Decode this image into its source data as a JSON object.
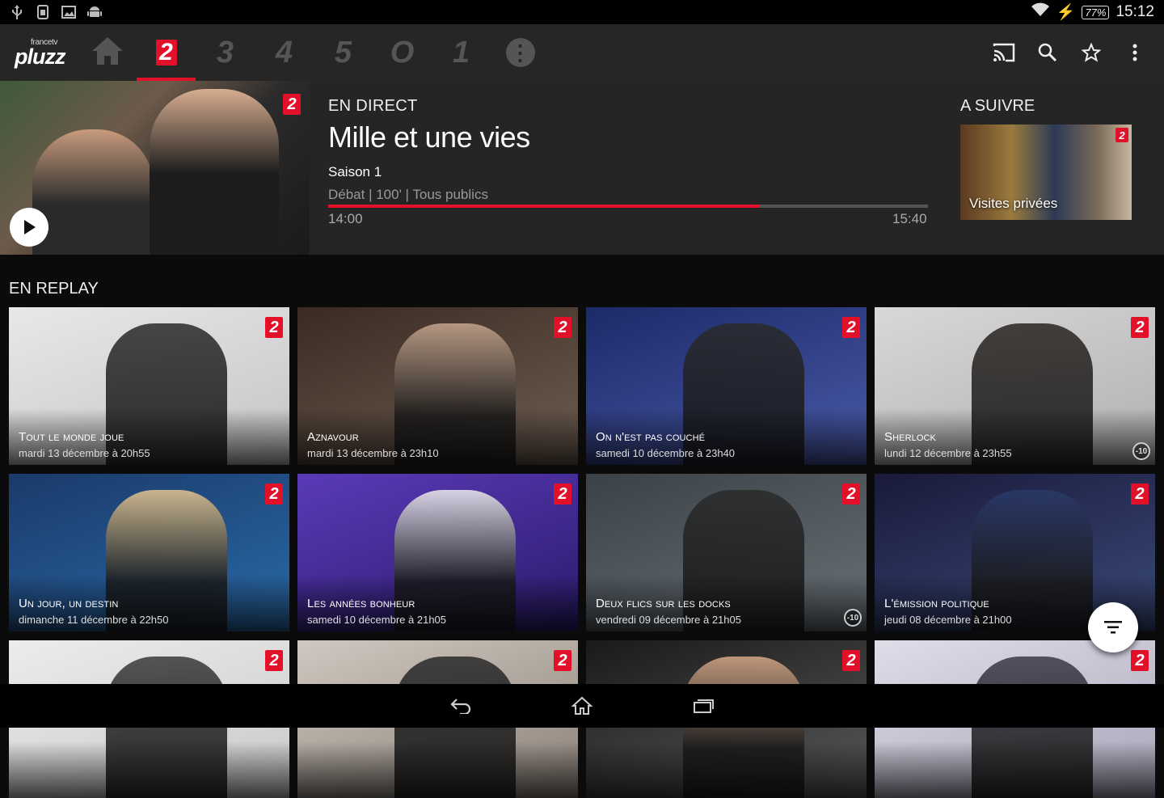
{
  "status_bar": {
    "time": "15:12",
    "battery": "77%",
    "left_icons": [
      "usb-icon",
      "sim-icon",
      "image-icon",
      "android-icon"
    ]
  },
  "app_bar": {
    "logo_small": "francetv",
    "logo_main": "pluzz",
    "channels": [
      {
        "icon": "home-icon",
        "label": "⌂",
        "active": false
      },
      {
        "icon": "channel-2-icon",
        "label": "2",
        "active": true
      },
      {
        "icon": "channel-3-icon",
        "label": "3",
        "active": false
      },
      {
        "icon": "channel-4-icon",
        "label": "4",
        "active": false
      },
      {
        "icon": "channel-5-icon",
        "label": "5",
        "active": false
      },
      {
        "icon": "channel-o-icon",
        "label": "O",
        "active": false
      },
      {
        "icon": "channel-1-icon",
        "label": "1",
        "active": false
      },
      {
        "icon": "more-channels-icon",
        "label": "⋮",
        "active": false
      }
    ],
    "actions": [
      "cast-icon",
      "search-icon",
      "favorite-star-icon",
      "overflow-menu-icon"
    ]
  },
  "live": {
    "label": "EN DIRECT",
    "title": "Mille et une vies",
    "season": "Saison 1",
    "meta": "Débat | 100' | Tous publics",
    "start": "14:00",
    "end": "15:40",
    "progress": 0.72,
    "channel_badge": "2"
  },
  "next": {
    "label": "A SUIVRE",
    "title": "Visites privées",
    "channel_badge": "2"
  },
  "replay": {
    "header": "EN REPLAY",
    "cards": [
      {
        "title": "Tout le monde joue",
        "date": "mardi 13 décembre à 20h55",
        "badge": "2",
        "rating": ""
      },
      {
        "title": "Aznavour",
        "date": "mardi 13 décembre à 23h10",
        "badge": "2",
        "rating": ""
      },
      {
        "title": "On n'est pas couché",
        "date": "samedi 10 décembre à 23h40",
        "badge": "2",
        "rating": ""
      },
      {
        "title": "Sherlock",
        "date": "lundi 12 décembre à 23h55",
        "badge": "2",
        "rating": "-10"
      },
      {
        "title": "Un jour, un destin",
        "date": "dimanche 11 décembre à 22h50",
        "badge": "2",
        "rating": ""
      },
      {
        "title": "Les années bonheur",
        "date": "samedi 10 décembre à 21h05",
        "badge": "2",
        "rating": ""
      },
      {
        "title": "Deux flics sur les docks",
        "date": "vendredi 09 décembre à 21h05",
        "badge": "2",
        "rating": "-10"
      },
      {
        "title": "L'émission politique",
        "date": "jeudi 08 décembre à 21h00",
        "badge": "2",
        "rating": ""
      },
      {
        "title": "",
        "date": "",
        "badge": "2",
        "rating": ""
      },
      {
        "title": "",
        "date": "",
        "badge": "2",
        "rating": ""
      },
      {
        "title": "",
        "date": "",
        "badge": "2",
        "rating": ""
      },
      {
        "title": "",
        "date": "",
        "badge": "2",
        "rating": ""
      }
    ]
  },
  "colors": {
    "accent": "#e3102a",
    "appbar": "#262626",
    "background": "#0b0b0b"
  },
  "fab_icon": "filter-icon",
  "nav": [
    "back-icon",
    "home-icon",
    "recents-icon"
  ]
}
